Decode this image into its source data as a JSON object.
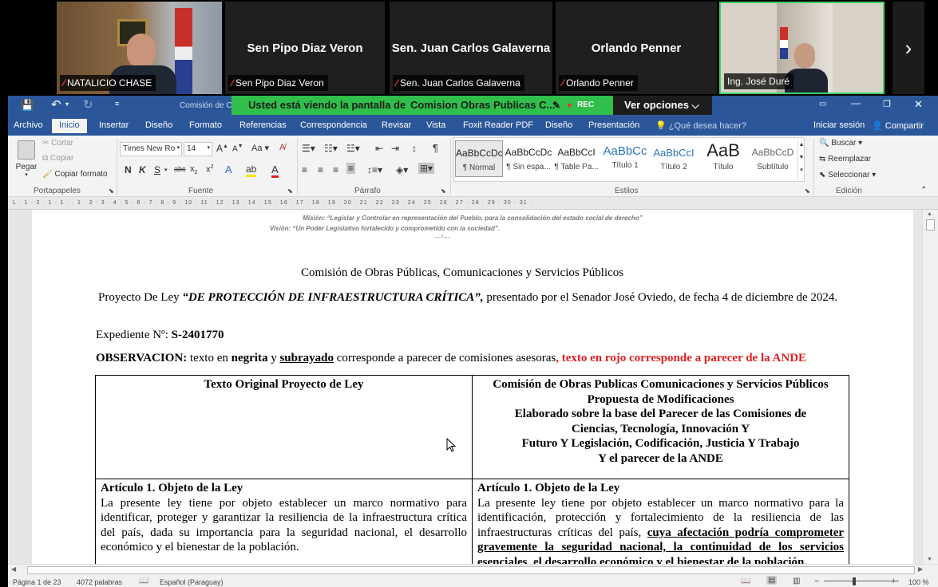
{
  "meeting": {
    "participants": [
      {
        "name": "NATALICIO CHASE",
        "muted": true,
        "video": true
      },
      {
        "name": "Sen Pipo Diaz Veron",
        "muted": true,
        "video": false
      },
      {
        "name": "Sen. Juan Carlos Galaverna",
        "muted": true,
        "video": false
      },
      {
        "name": "Orlando Penner",
        "muted": true,
        "video": false
      },
      {
        "name": "Ing. José Duré",
        "muted": false,
        "video": true,
        "active_speaker": true
      }
    ],
    "next_icon": "chevron-right-icon",
    "share_banner": {
      "prefix": "Usted está viendo la pantalla de",
      "sharer": "Comision Obras Publicas C...",
      "rec": "REC"
    },
    "view_options": "Ver opciones"
  },
  "word": {
    "title_fragment": "Comisión de C",
    "tabs": [
      "Archivo",
      "Inicio",
      "Insertar",
      "Diseño",
      "Formato",
      "Referencias",
      "Correspondencia",
      "Revisar",
      "Vista",
      "Foxit Reader PDF",
      "Diseño",
      "Presentación"
    ],
    "active_tab": "Inicio",
    "tell_me": "¿Qué desea hacer?",
    "sign_in": "Iniciar sesión",
    "share": "Compartir",
    "clipboard": {
      "paste": "Pegar",
      "cut": "Cortar",
      "copy": "Copiar",
      "format_painter": "Copiar formato",
      "group": "Portapapeles"
    },
    "font": {
      "name": "Times New Ro",
      "size": "14",
      "group": "Fuente"
    },
    "paragraph_group": "Párrafo",
    "styles": [
      {
        "preview": "AaBbCcDc",
        "label": "¶ Normal"
      },
      {
        "preview": "AaBbCcDc",
        "label": "¶ Sin espa..."
      },
      {
        "preview": "AaBbCcI",
        "label": "¶ Table Pa..."
      },
      {
        "preview": "AaBbCc",
        "label": "Título 1"
      },
      {
        "preview": "AaBbCcI",
        "label": "Título 2"
      },
      {
        "preview": "AaB",
        "label": "Título"
      },
      {
        "preview": "AaBbCcD",
        "label": "Subtítulo"
      }
    ],
    "styles_group": "Estilos",
    "editing": {
      "find": "Buscar",
      "replace": "Reemplazar",
      "select": "Seleccionar",
      "group": "Edición"
    },
    "ruler_text": "L · 1 · 2 · 1 · 1 · · 1 · 2 · 3 · 4 · 5 · 6 · 7 · 8 · 9 · 10 · 11 · 12 · 13 · 14 · 15 · 16 · 17 · 18 · 19 · 20 · 21 · 22 · 23 · 24 · 25 · 26 · 27 · 28 · 29 · 30 · 31 ·",
    "status": {
      "page": "Página 1 de 23",
      "words": "4072 palabras",
      "language": "Español (Paraguay)",
      "zoom": "100 %"
    }
  },
  "document": {
    "mision": "Misión: “Legislar y Controlar en representación del Pueblo, para la consolidación del estado social de derecho”",
    "vision": "Visión: “Un Poder Legislativo fortalecido y comprometido con la sociedad”.",
    "ornament": "---°---",
    "heading": "Comisión de Obras Públicas, Comunicaciones y Servicios Públicos",
    "proyecto_prefix": "Proyecto De Ley ",
    "proyecto_title": "“DE PROTECCIÓN DE INFRAESTRUCTURA CRÍTICA”,",
    "proyecto_suffix": " presentado por el Senador José Oviedo, de fecha 4 de diciembre de 2024.",
    "expediente_label": "Expediente Nº: ",
    "expediente_num": "S-2401770",
    "obs_label": "OBSERVACION:",
    "obs_t1": " texto en ",
    "obs_bold": "negrita",
    "obs_t2": " y ",
    "obs_underline": "subrayado",
    "obs_t3": " corresponde a parecer de comisiones asesoras",
    "obs_red": ", texto en rojo corresponde a parecer de la ANDE",
    "table": {
      "col1_header": "Texto Original Proyecto de Ley",
      "col2_header_lines": [
        "Comisión de Obras Publicas Comunicaciones y Servicios Públicos",
        "Propuesta de Modificaciones",
        "Elaborado sobre la base del Parecer de las Comisiones de",
        "Ciencias, Tecnología, Innovación Y",
        "Futuro Y Legislación, Codificación, Justicia Y Trabajo",
        "Y el parecer de la ANDE"
      ],
      "art1_title": "Artículo 1. Objeto de la Ley",
      "art1_original": "La presente ley tiene por objeto establecer un marco normativo para identificar, proteger y garantizar la resiliencia de la infraestructura crítica del país, dada su importancia para la seguridad nacional, el desarrollo económico y el bienestar de la población.",
      "art1_mod_plain": "La presente ley tiene por objeto establecer un marco normativo para la identificación, protección y fortalecimiento de la resiliencia de las infraestructuras críticas del país, ",
      "art1_mod_underlined": "cuya afectación podría comprometer gravemente la seguridad nacional, la continuidad de los servicios esenciales, el desarrollo económico y el bienestar de la población."
    }
  }
}
